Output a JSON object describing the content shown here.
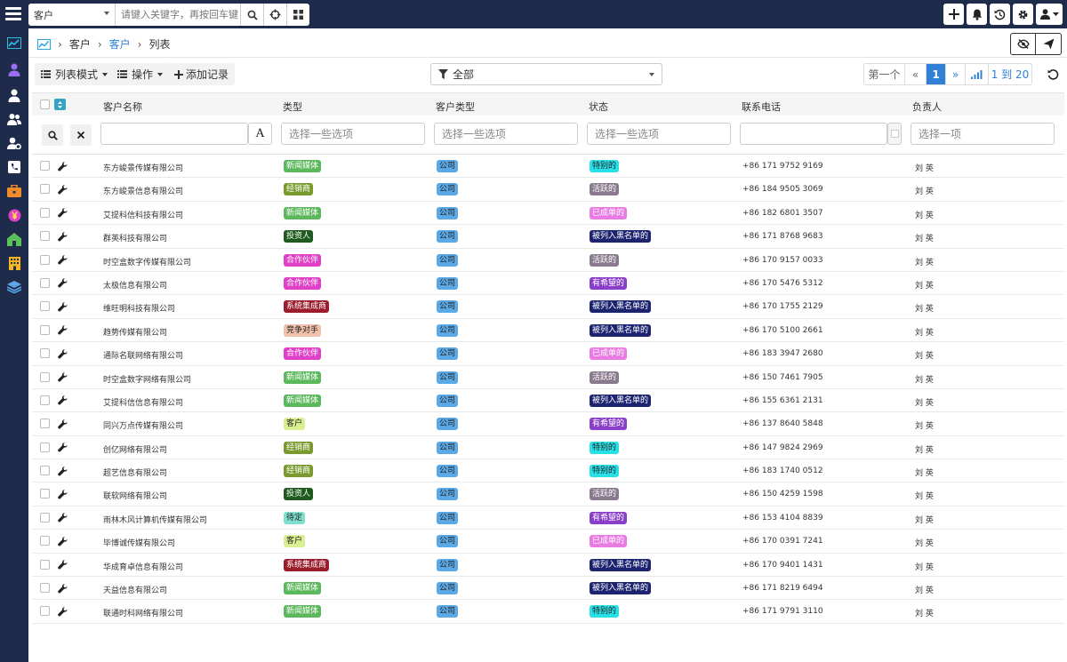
{
  "topbar": {
    "scope": "客户",
    "search_placeholder": "请键入关键字，再按回车键"
  },
  "breadcrumb": {
    "home_icon": "chart-line-icon",
    "level1": "客户",
    "level2": "客户",
    "current": "列表"
  },
  "toolbar": {
    "list_mode": "列表模式",
    "actions": "操作",
    "add_record": "添加记录",
    "filter_value": "全部",
    "pager": {
      "first": "第一个",
      "prev": "«",
      "current": "1",
      "next": "»",
      "range": "1 到 20"
    }
  },
  "columns": [
    "客户名称",
    "类型",
    "客户类型",
    "状态",
    "联系电话",
    "负责人"
  ],
  "filters": {
    "type_placeholder": "选择一些选项",
    "customer_type_placeholder": "选择一些选项",
    "status_placeholder": "选择一些选项",
    "owner_placeholder": "选择一项",
    "name_toggle": "A"
  },
  "tag_colors": {
    "新闻媒体": "#5cb85c",
    "经销商": "#7a9a2e",
    "投资人": "#1f5a1f",
    "合作伙伴": "#e040c8",
    "系统集成商": "#9b1d2b",
    "竞争对手": "#f2c1ad",
    "客户": "#d9ef92",
    "待定": "#7fe0cd",
    "公司": "#5aa9e6",
    "特别的": "#28e0e8",
    "活跃的": "#8a7a8e",
    "已成单的": "#e97be3",
    "被列入黑名单的": "#1c2470",
    "有希望的": "#8a3fc8"
  },
  "rows": [
    {
      "name": "东方峻景传媒有限公司",
      "type": "新闻媒体",
      "ctype": "公司",
      "status": "特别的",
      "phone": "+86 171 9752 9169",
      "owner": "刘 英"
    },
    {
      "name": "东方峻景信息有限公司",
      "type": "经销商",
      "ctype": "公司",
      "status": "活跃的",
      "phone": "+86 184 9505 3069",
      "owner": "刘 英"
    },
    {
      "name": "艾提科信科技有限公司",
      "type": "新闻媒体",
      "ctype": "公司",
      "status": "已成单的",
      "phone": "+86 182 6801 3507",
      "owner": "刘 英"
    },
    {
      "name": "群英科技有限公司",
      "type": "投资人",
      "ctype": "公司",
      "status": "被列入黑名单的",
      "phone": "+86 171 8768 9683",
      "owner": "刘 英"
    },
    {
      "name": "时空盒数字传媒有限公司",
      "type": "合作伙伴",
      "ctype": "公司",
      "status": "活跃的",
      "phone": "+86 170 9157 0033",
      "owner": "刘 英"
    },
    {
      "name": "太极信息有限公司",
      "type": "合作伙伴",
      "ctype": "公司",
      "status": "有希望的",
      "phone": "+86 170 5476 5312",
      "owner": "刘 英"
    },
    {
      "name": "维旺明科技有限公司",
      "type": "系统集成商",
      "ctype": "公司",
      "status": "被列入黑名单的",
      "phone": "+86 170 1755 2129",
      "owner": "刘 英"
    },
    {
      "name": "趋势传媒有限公司",
      "type": "竞争对手",
      "ctype": "公司",
      "status": "被列入黑名单的",
      "phone": "+86 170 5100 2661",
      "owner": "刘 英"
    },
    {
      "name": "通际名联网络有限公司",
      "type": "合作伙伴",
      "ctype": "公司",
      "status": "已成单的",
      "phone": "+86 183 3947 2680",
      "owner": "刘 英"
    },
    {
      "name": "时空盒数字网络有限公司",
      "type": "新闻媒体",
      "ctype": "公司",
      "status": "活跃的",
      "phone": "+86 150 7461 7905",
      "owner": "刘 英"
    },
    {
      "name": "艾提科信信息有限公司",
      "type": "新闻媒体",
      "ctype": "公司",
      "status": "被列入黑名单的",
      "phone": "+86 155 6361 2131",
      "owner": "刘 英"
    },
    {
      "name": "同兴万点传媒有限公司",
      "type": "客户",
      "ctype": "公司",
      "status": "有希望的",
      "phone": "+86 137 8640 5848",
      "owner": "刘 英"
    },
    {
      "name": "创亿网络有限公司",
      "type": "经销商",
      "ctype": "公司",
      "status": "特别的",
      "phone": "+86 147 9824 2969",
      "owner": "刘 英"
    },
    {
      "name": "超艺信息有限公司",
      "type": "经销商",
      "ctype": "公司",
      "status": "特别的",
      "phone": "+86 183 1740 0512",
      "owner": "刘 英"
    },
    {
      "name": "联软网络有限公司",
      "type": "投资人",
      "ctype": "公司",
      "status": "活跃的",
      "phone": "+86 150 4259 1598",
      "owner": "刘 英"
    },
    {
      "name": "雨林木风计算机传媒有限公司",
      "type": "待定",
      "ctype": "公司",
      "status": "有希望的",
      "phone": "+86 153 4104 8839",
      "owner": "刘 英"
    },
    {
      "name": "毕博诚传媒有限公司",
      "type": "客户",
      "ctype": "公司",
      "status": "已成单的",
      "phone": "+86 170 0391 7241",
      "owner": "刘 英"
    },
    {
      "name": "华成育卓信息有限公司",
      "type": "系统集成商",
      "ctype": "公司",
      "status": "被列入黑名单的",
      "phone": "+86 170 9401 1431",
      "owner": "刘 英"
    },
    {
      "name": "天益信息有限公司",
      "type": "新闻媒体",
      "ctype": "公司",
      "status": "被列入黑名单的",
      "phone": "+86 171 8219 6494",
      "owner": "刘 英"
    },
    {
      "name": "联通时科网络有限公司",
      "type": "新闻媒体",
      "ctype": "公司",
      "status": "特别的",
      "phone": "+86 171 9791 3110",
      "owner": "刘 英"
    }
  ]
}
